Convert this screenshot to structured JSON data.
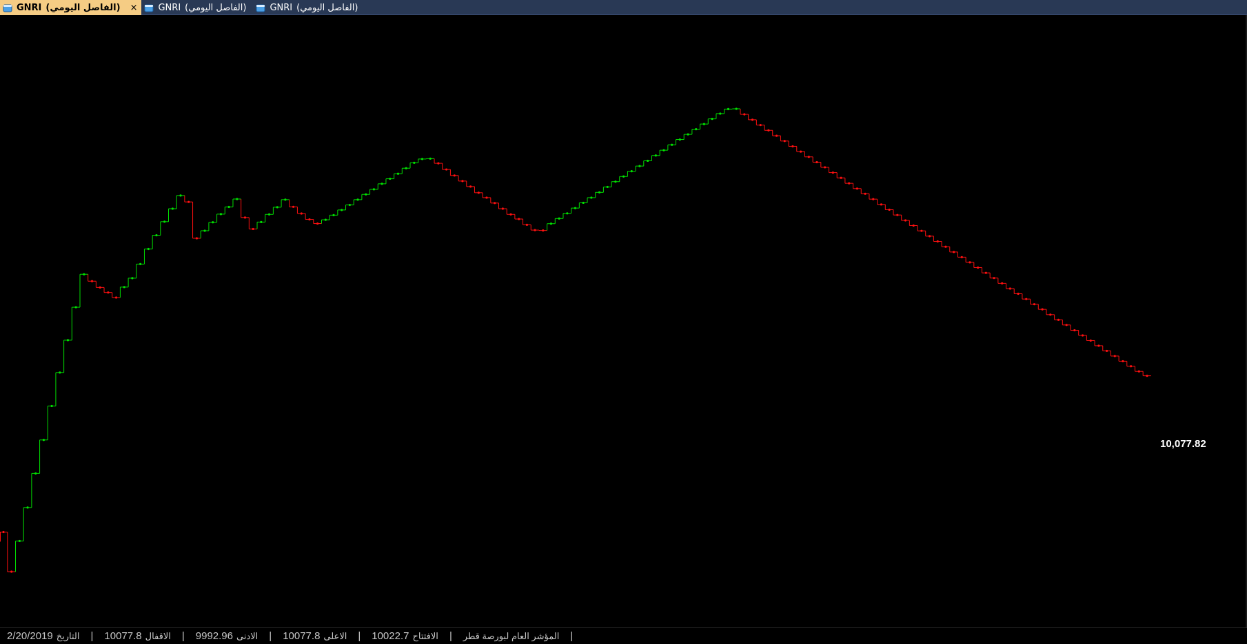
{
  "tabs": [
    {
      "symbol": "GNRI",
      "interval": "(الفاصل اليومي)",
      "active": true,
      "close": "×"
    },
    {
      "symbol": "GNRI",
      "interval": "(الفاصل اليومي)",
      "active": false
    },
    {
      "symbol": "GNRI",
      "interval": "(الفاصل اليومي)",
      "active": false
    }
  ],
  "chart": {
    "last_price_label": "10,077.82",
    "up_color": "#00e000",
    "down_color": "#ff1010",
    "background": "#000000"
  },
  "chart_data": {
    "type": "line",
    "style": "step",
    "title": "",
    "xlabel": "",
    "ylabel": "",
    "grid": false,
    "last_value": 10077.82,
    "series": [
      {
        "values": [
          9953.6,
          9922.1,
          9946.5,
          9973.1,
          10000.2,
          10026.8,
          10053.8,
          10080.4,
          10106.1,
          10132.3,
          10158.5,
          10153.0,
          10148.0,
          10144.0,
          10140.0,
          10148.3,
          10155.4,
          10166.6,
          10178.6,
          10189.5,
          10200.3,
          10210.6,
          10221.1,
          10216.0,
          10187.1,
          10193.1,
          10199.8,
          10206.3,
          10212.0,
          10218.3,
          10203.6,
          10194.5,
          10200.0,
          10206.1,
          10211.8,
          10217.8,
          10212.1,
          10206.8,
          10202.1,
          10198.8,
          10201.8,
          10205.5,
          10209.6,
          10213.6,
          10217.8,
          10222.0,
          10226.0,
          10230.4,
          10234.4,
          10238.4,
          10242.8,
          10247.1,
          10250.1,
          10250.4,
          10246.7,
          10241.8,
          10237.0,
          10232.6,
          10228.2,
          10223.3,
          10219.4,
          10215.1,
          10210.6,
          10206.1,
          10202.4,
          10197.8,
          10193.6,
          10193.3,
          10198.7,
          10202.8,
          10206.9,
          10211.1,
          10215.3,
          10219.4,
          10223.6,
          10227.9,
          10232.1,
          10236.2,
          10240.4,
          10244.5,
          10248.7,
          10252.9,
          10257.1,
          10261.4,
          10265.6,
          10269.7,
          10273.8,
          10277.9,
          10282.0,
          10286.2,
          10289.8,
          10290.0,
          10285.6,
          10281.3,
          10277.1,
          10272.9,
          10268.6,
          10264.4,
          10260.2,
          10256.0,
          10251.8,
          10247.6,
          10243.5,
          10239.3,
          10235.1,
          10230.8,
          10226.6,
          10222.5,
          10218.2,
          10214.0,
          10209.8,
          10205.6,
          10201.3,
          10197.2,
          10193.0,
          10188.8,
          10184.6,
          10180.4,
          10176.2,
          10172.1,
          10168.0,
          10163.8,
          10159.6,
          10155.5,
          10151.3,
          10147.1,
          10143.0,
          10138.8,
          10134.7,
          10130.6,
          10126.4,
          10122.3,
          10118.2,
          10114.0,
          10109.9,
          10105.8,
          10101.7,
          10097.6,
          10093.5,
          10089.4,
          10085.4,
          10081.3,
          10077.8
        ]
      }
    ]
  },
  "status": {
    "date_label": "التاريخ",
    "date_value": "2/20/2019",
    "close_label": "الاقفال",
    "close_value": "10077.8",
    "low_label": "الادنى",
    "low_value": "9992.96",
    "high_label": "الاعلى",
    "high_value": "10077.8",
    "open_label": "الافتتاح",
    "open_value": "10022.7",
    "index_name": "المؤشر العام لبورصة قطر",
    "separator": "|"
  }
}
